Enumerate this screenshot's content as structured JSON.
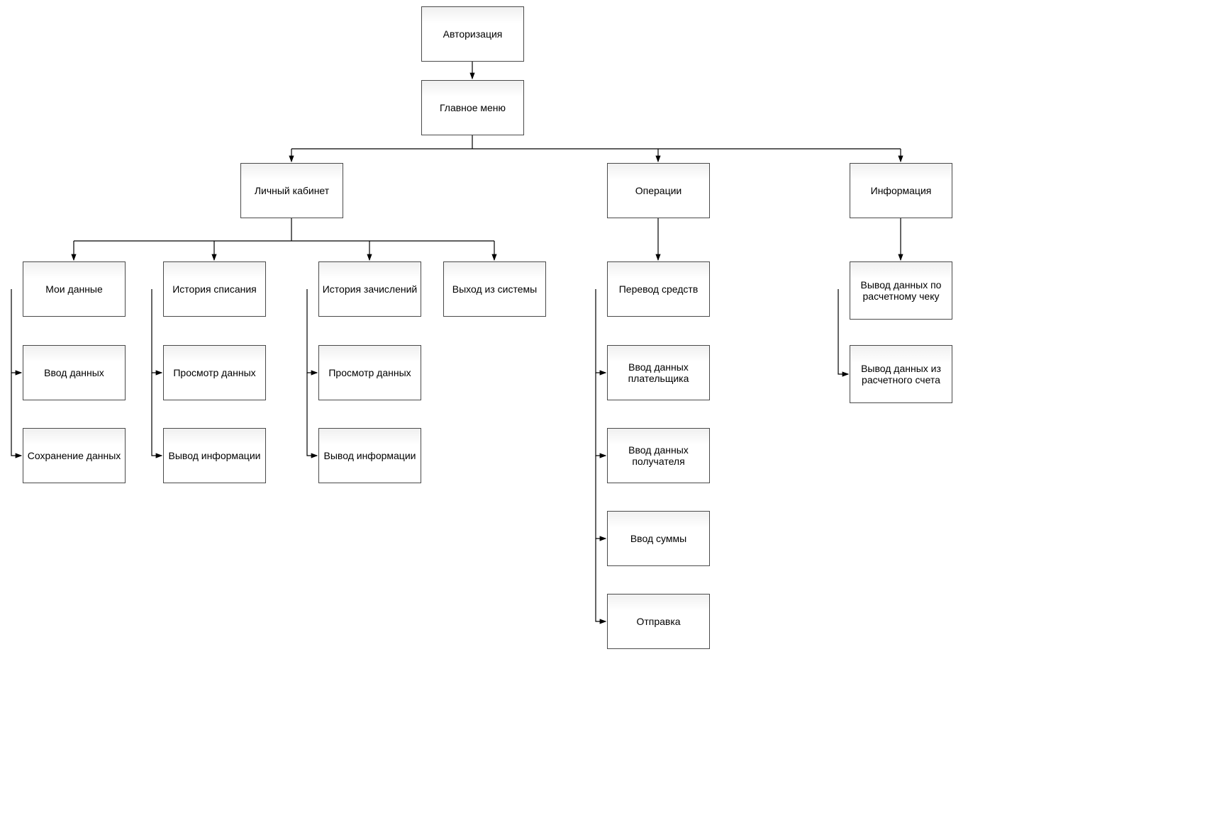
{
  "nodes": {
    "auth": "Авторизация",
    "main_menu": "Главное меню",
    "personal": "Личный кабинет",
    "operations": "Операции",
    "info": "Информация",
    "my_data": "Мои данные",
    "history_write": "История списания",
    "history_credit": "История зачислений",
    "logout": "Выход из системы",
    "transfer": "Перевод средств",
    "info_check": "Вывод данных по расчетному чеку",
    "info_account": "Вывод данных из расчетного счета",
    "enter_data": "Ввод данных",
    "save_data": "Сохранение данных",
    "view_data1": "Просмотр данных",
    "output_info1": "Вывод информации",
    "view_data2": "Просмотр данных",
    "output_info2": "Вывод информации",
    "payer_data": "Ввод данных плательщика",
    "recipient_data": "Ввод данных получателя",
    "enter_sum": "Ввод суммы",
    "send": "Отправка"
  }
}
